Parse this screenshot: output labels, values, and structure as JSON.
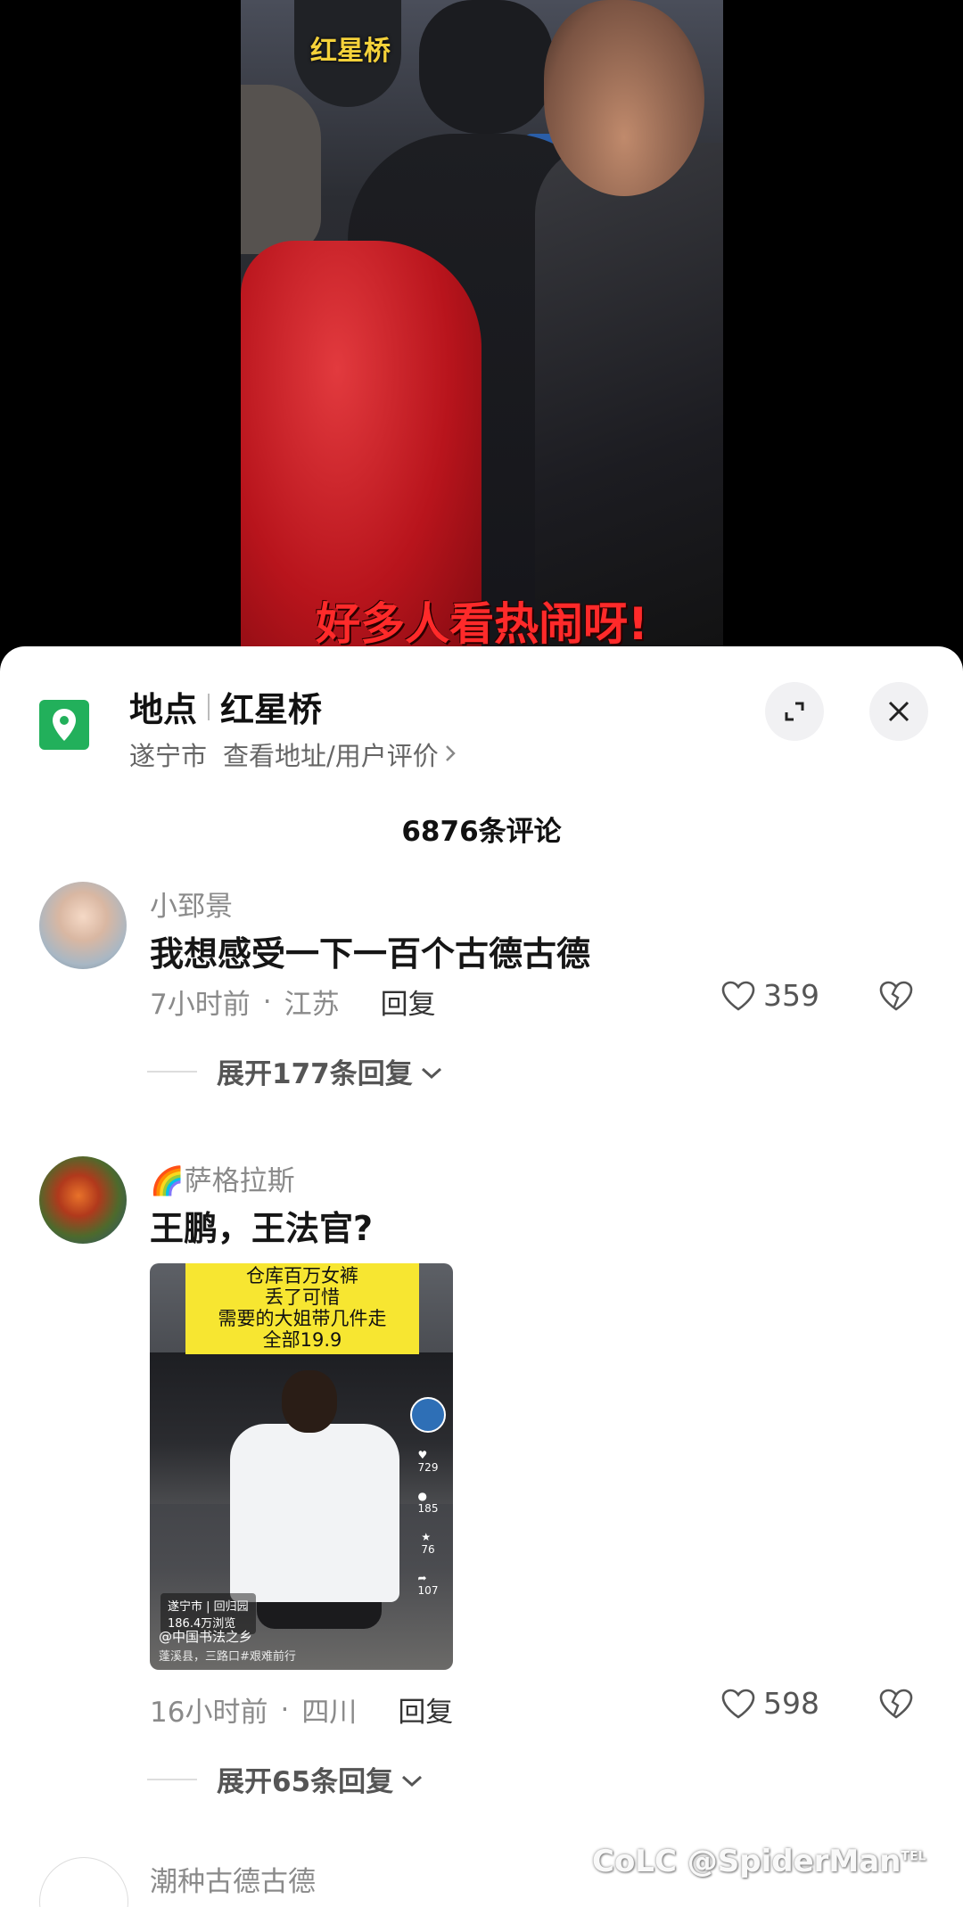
{
  "video": {
    "location_tag": "红星桥",
    "caption": "好多人看热闹呀!"
  },
  "location_header": {
    "label": "地点",
    "place": "红星桥",
    "city": "遂宁市",
    "link": "查看地址/用户评价",
    "icon": "location-pin-icon"
  },
  "comments_count": "6876条评论",
  "comments": [
    {
      "user": "小郅景",
      "text": "我想感受一下一百个古德古德",
      "time": "7小时前",
      "region": "江苏",
      "reply_label": "回复",
      "likes": "359",
      "expand_replies": "展开177条回复"
    },
    {
      "user": "萨格拉斯",
      "user_emoji": "🌈",
      "text": "王鹏，王法官?",
      "time": "16小时前",
      "region": "四川",
      "reply_label": "回复",
      "likes": "598",
      "expand_replies": "展开65条回复",
      "attachment": {
        "yellow_text_1": "仓库百万女裤",
        "yellow_text_2": "丢了可惜",
        "yellow_text_3": "需要的大姐带几件走",
        "yellow_text_4": "全部19.9",
        "likes": "729",
        "comments": "185",
        "favorites": "76",
        "shares": "107",
        "location_chip": "遂宁市 | 回归园",
        "views": "186.4万浏览",
        "author": "@中国书法之乡",
        "description": "蓬溪县，三路口#艰难前行"
      }
    },
    {
      "user": "潮种古德古德"
    }
  ],
  "watermark": {
    "brand": "CoLC",
    "handle": "@SpiderMan",
    "sup": "TEL"
  }
}
